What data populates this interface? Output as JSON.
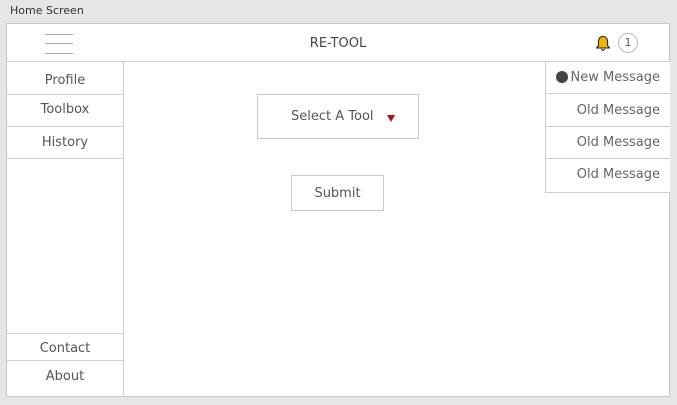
{
  "window": {
    "title": "Home Screen"
  },
  "header": {
    "title": "RE-TOOL",
    "notification_count": "1"
  },
  "sidebar": {
    "top_items": [
      {
        "label": "Profile"
      },
      {
        "label": "Toolbox"
      },
      {
        "label": "History"
      }
    ],
    "bottom_items": [
      {
        "label": "Contact"
      },
      {
        "label": "About"
      }
    ]
  },
  "main": {
    "tool_select": {
      "label": "Select A Tool"
    },
    "submit_label": "Submit"
  },
  "messages": [
    {
      "label": "New Message",
      "unread": true
    },
    {
      "label": "Old Message",
      "unread": false
    },
    {
      "label": "Old Message",
      "unread": false
    },
    {
      "label": "Old Message",
      "unread": false
    }
  ],
  "colors": {
    "bell": "#f0b400",
    "dropdown_arrow": "#b01010",
    "unread_dot": "#444444"
  },
  "icons": [
    "hamburger-icon",
    "bell-icon",
    "dropdown-arrow-icon",
    "unread-dot-icon"
  ]
}
